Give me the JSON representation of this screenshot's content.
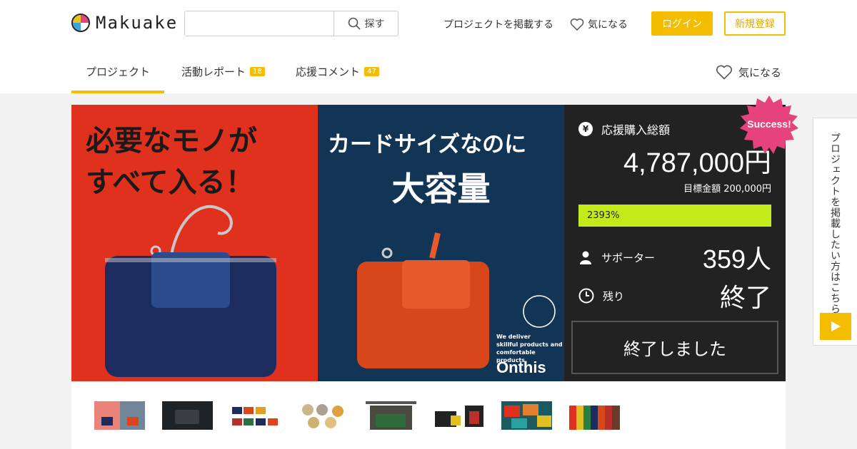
{
  "header": {
    "logo_text": "Makuake",
    "search_placeholder": "",
    "search_button": "探す",
    "post_project": "プロジェクトを掲載する",
    "favorites": "気になる",
    "login": "ログイン",
    "signup": "新規登録"
  },
  "tabs": {
    "project": "プロジェクト",
    "report": "活動レポート",
    "report_count": "18",
    "comment": "応援コメント",
    "comment_count": "47",
    "favorite": "気になる"
  },
  "hero": {
    "left_headline_1": "必要なモノが",
    "left_headline_2": "すべて入る！",
    "right_headline_1": "カードサイズなのに",
    "right_headline_2": "大容量",
    "copy_1": "We deliver",
    "copy_2": "skillful products and",
    "copy_3": "comfortable products.",
    "brand": "Onthis",
    "colors": {
      "left_bg": "#e0301e",
      "right_bg": "#123556"
    }
  },
  "funding": {
    "total_label": "応援購入総額",
    "total_amount": "4,787,000円",
    "goal": "目標金額 200,000円",
    "progress_text": "2393%",
    "progress_fraction": 1.0,
    "supporters_label": "サポーター",
    "supporters_value": "359人",
    "remaining_label": "残り",
    "remaining_value": "終了",
    "ended_button": "終了しました",
    "success_badge": "Success!",
    "colors": {
      "panel": "#222222",
      "progress": "#c5ea1a",
      "accent": "#f5bd00",
      "badge": "#e6437c"
    }
  },
  "side_cta": {
    "text": "プロジェクトを掲載したい方はこちら"
  },
  "thumbnails": [
    {
      "name": "thumb-1"
    },
    {
      "name": "thumb-2"
    },
    {
      "name": "thumb-3"
    },
    {
      "name": "thumb-4"
    },
    {
      "name": "thumb-5"
    },
    {
      "name": "thumb-6"
    },
    {
      "name": "thumb-7"
    },
    {
      "name": "thumb-8"
    }
  ]
}
